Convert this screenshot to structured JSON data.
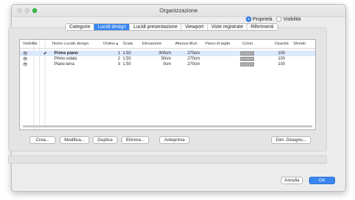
{
  "window": {
    "title": "Organizzazione"
  },
  "radios": [
    {
      "label": "Proprietà",
      "selected": true
    },
    {
      "label": "Visibilità",
      "selected": false
    }
  ],
  "tabs": [
    {
      "label": "Categorie",
      "active": false
    },
    {
      "label": "Lucidi design",
      "active": true
    },
    {
      "label": "Lucidi presentazione",
      "active": false
    },
    {
      "label": "Viewport",
      "active": false
    },
    {
      "label": "Viste registrate",
      "active": false
    },
    {
      "label": "Riferimenti",
      "active": false
    }
  ],
  "table": {
    "headers": {
      "visibility": "Visibilità",
      "name": "Nome Lucido design",
      "order": "Ordine ▴",
      "scale": "Scala",
      "elevation": "Elevazione",
      "wall_height": "Altezza Muri",
      "cut_plane": "Piano di taglio",
      "colors": "Colori",
      "opacity": "Opacità",
      "background": "Sfondo"
    },
    "rows": [
      {
        "name": "Primo piano",
        "order": "1",
        "scale": "1:50",
        "elevation": "300cm",
        "wall_height": "270cm",
        "opacity": "100",
        "active": true
      },
      {
        "name": "Primo solaio",
        "order": "2",
        "scale": "1:50",
        "elevation": "30cm",
        "wall_height": "270cm",
        "opacity": "100",
        "active": false
      },
      {
        "name": "Piano terra",
        "order": "3",
        "scale": "1:50",
        "elevation": "0cm",
        "wall_height": "270cm",
        "opacity": "100",
        "active": false
      }
    ],
    "eye_icon": "👁",
    "check_glyph": "✔"
  },
  "buttons": {
    "create": "Crea...",
    "modify": "Modifica...",
    "duplicate": "Duplica",
    "delete": "Elimina...",
    "preview": "Anteprima",
    "dim_drawing": "Dim. Disegno...",
    "cancel": "Annulla",
    "ok": "OK"
  },
  "colors": {
    "accent": "#3a86f0",
    "selected_row": "#dce8fb",
    "maximize": "#3fc14a"
  }
}
